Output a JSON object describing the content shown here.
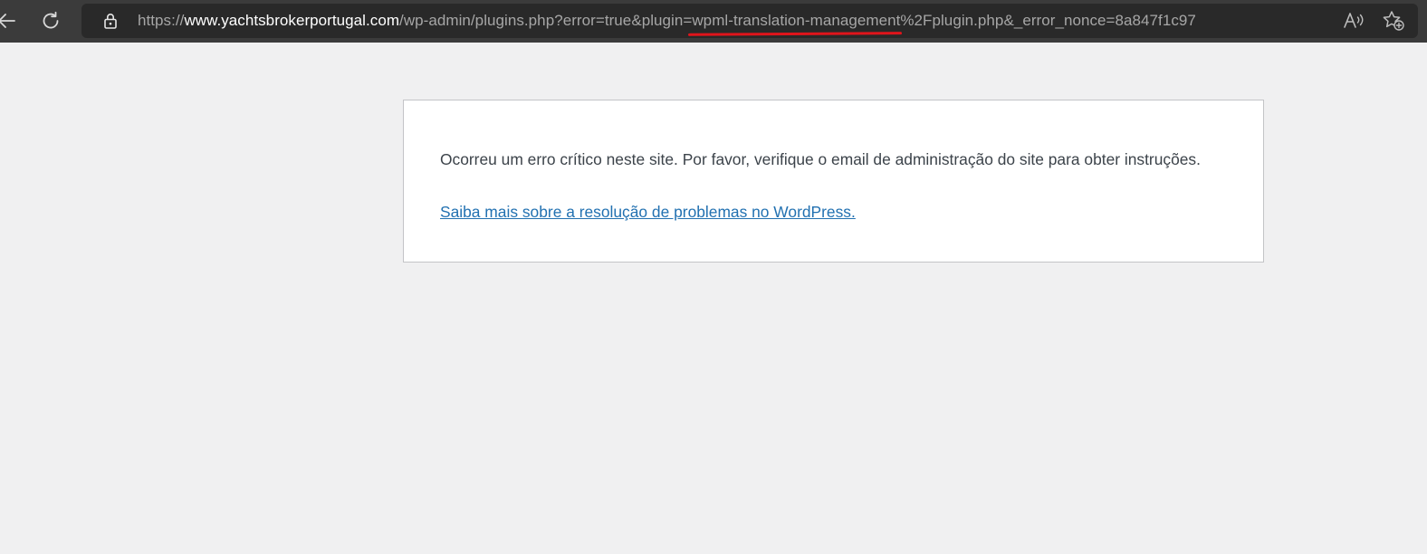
{
  "browser": {
    "icons": {
      "back": "arrow-left-icon",
      "reload": "reload-icon",
      "lock": "lock-icon",
      "read_aloud": "read-aloud-icon",
      "favorite": "star-add-icon"
    },
    "url": {
      "scheme": "https://",
      "host": "www.yachtsbrokerportugal.com",
      "path_before_mark": "/wp-admin/plugins.php?error=true&plugin=",
      "marked": "wpml-translation-management",
      "path_after_mark": "%2Fplugin.php&_error_nonce=8a847f1c97"
    },
    "annotation_color": "#e0141b"
  },
  "page": {
    "message": "Ocorreu um erro crítico neste site. Por favor, verifique o email de administração do site para obter instruções.",
    "help_link": "Saiba mais sobre a resolução de problemas no WordPress.",
    "link_color": "#2271b1",
    "background": "#f0f0f1"
  }
}
